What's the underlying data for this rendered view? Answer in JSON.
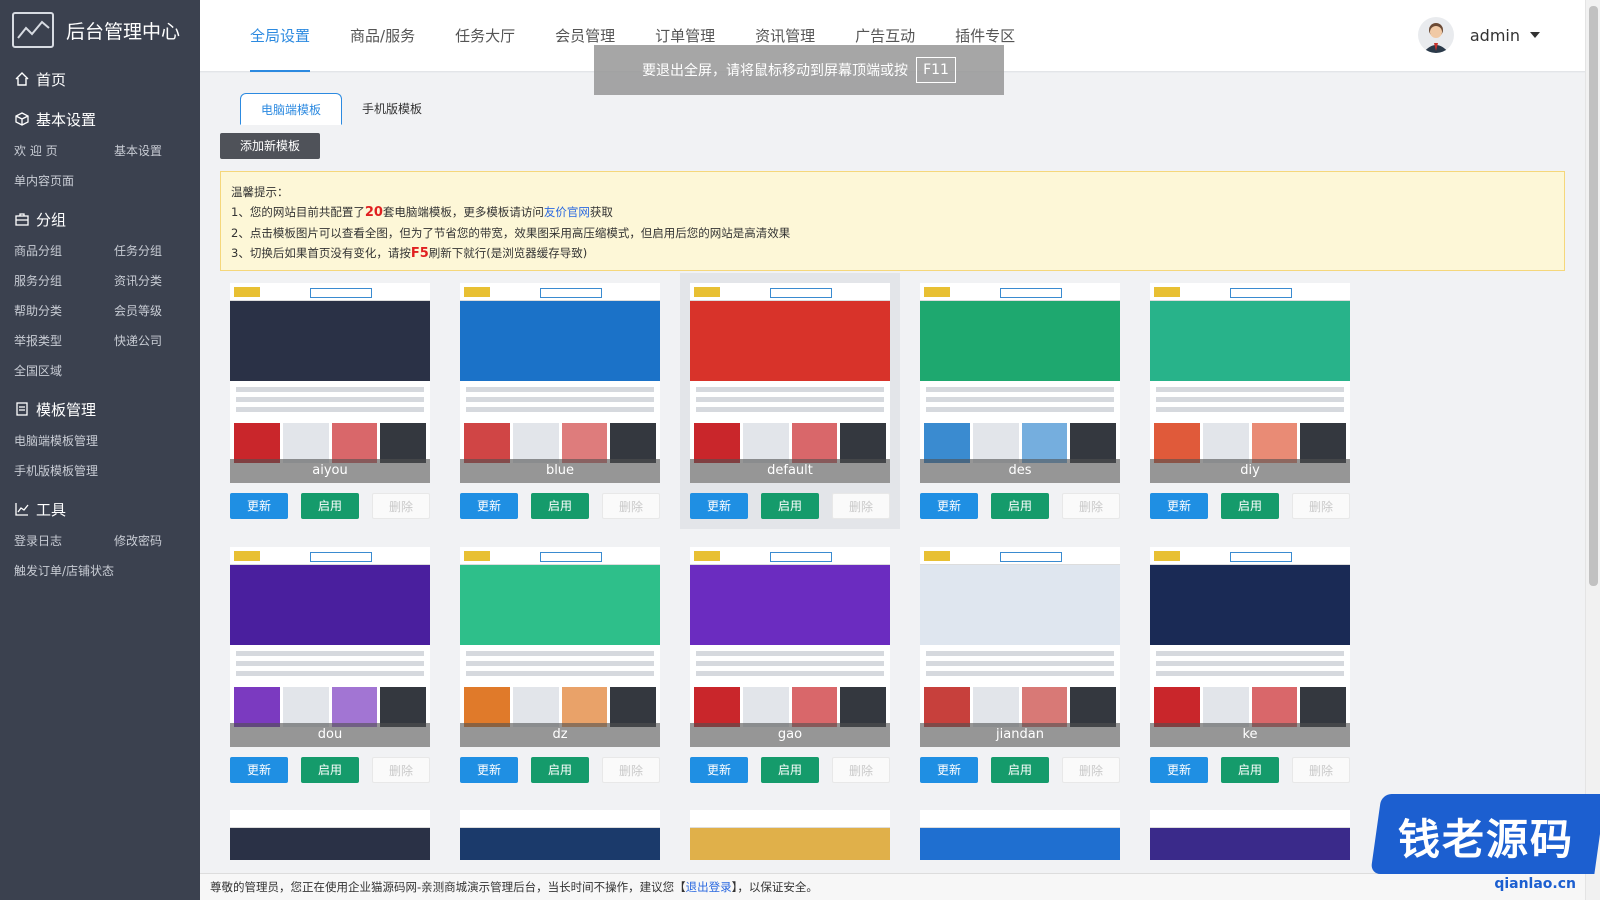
{
  "brand": {
    "title": "后台管理中心"
  },
  "sidebar": {
    "home": "首页",
    "sections": [
      {
        "title": "基本设置",
        "icon": "cube-icon",
        "links": [
          "欢 迎 页",
          "基本设置",
          "单内容页面"
        ]
      },
      {
        "title": "分组",
        "icon": "briefcase-icon",
        "links": [
          "商品分组",
          "任务分组",
          "服务分组",
          "资讯分类",
          "帮助分类",
          "会员等级",
          "举报类型",
          "快递公司",
          "全国区域"
        ]
      },
      {
        "title": "模板管理",
        "icon": "document-icon",
        "links": [
          "电脑端模板管理",
          "手机版模板管理"
        ]
      },
      {
        "title": "工具",
        "icon": "chart-icon",
        "links": [
          "登录日志",
          "修改密码",
          "触发订单/店铺状态"
        ]
      }
    ]
  },
  "topnav": {
    "items": [
      "全局设置",
      "商品/服务",
      "任务大厅",
      "会员管理",
      "订单管理",
      "资讯管理",
      "广告互动",
      "插件专区"
    ],
    "active": "全局设置"
  },
  "user": {
    "name": "admin"
  },
  "fullscreen_tip": {
    "text": "要退出全屏，请将鼠标移动到屏幕顶端或按",
    "key": "F11"
  },
  "subtabs": {
    "items": [
      "电脑端模板",
      "手机版模板"
    ],
    "active": "电脑端模板"
  },
  "actions": {
    "add_template": "添加新模板"
  },
  "notice": {
    "title": "温馨提示：",
    "line1_pre": "1、您的网站目前共配置了",
    "line1_count": "20",
    "line1_mid": "套电脑端模板，更多模板请访问",
    "line1_link": "友价官网",
    "line1_post": "获取",
    "line2": "2、点击模板图片可以查看全图，但为了节省您的带宽，效果图采用高压缩模式，但启用后您的网站是高清效果",
    "line3_pre": "3、切换后如果首页没有变化，请按",
    "line3_key": "F5",
    "line3_post": "刷新下就行(是浏览器缓存导致)"
  },
  "template_buttons": {
    "update": "更新",
    "enable": "启用",
    "delete": "删除"
  },
  "templates": [
    {
      "name": "aiyou",
      "selected": false,
      "banner_color": "#2a3146",
      "block_color": "#c9262b"
    },
    {
      "name": "blue",
      "selected": false,
      "banner_color": "#1b72c8",
      "block_color": "#d04545"
    },
    {
      "name": "default",
      "selected": true,
      "banner_color": "#d8332a",
      "block_color": "#c9262b"
    },
    {
      "name": "des",
      "selected": false,
      "banner_color": "#1ea86f",
      "block_color": "#3a8bd0"
    },
    {
      "name": "diy",
      "selected": false,
      "banner_color": "#28b38a",
      "block_color": "#e05a3a"
    },
    {
      "name": "dou",
      "selected": false,
      "banner_color": "#4a1f9e",
      "block_color": "#7b3ac0"
    },
    {
      "name": "dz",
      "selected": false,
      "banner_color": "#2ebf8a",
      "block_color": "#e07a2a"
    },
    {
      "name": "gao",
      "selected": false,
      "banner_color": "#6b2cc0",
      "block_color": "#c9262b"
    },
    {
      "name": "jiandan",
      "selected": false,
      "banner_color": "#dfe6ef",
      "block_color": "#c7403c"
    },
    {
      "name": "ke",
      "selected": false,
      "banner_color": "#1a2a55",
      "block_color": "#c9262b"
    }
  ],
  "partial_row_colors": [
    "#2a3146",
    "#1b3a6b",
    "#e0b04a",
    "#1f6fd0",
    "#3a2a8a"
  ],
  "footer": {
    "pre": "尊敬的管理员，您正在使用企业猫源码网-亲测商城演示管理后台，当长时间不操作，建议您【",
    "link": "退出登录",
    "post": "】，以保证安全。"
  },
  "watermark": {
    "text": "钱老源码",
    "url": "qianlao.cn"
  }
}
